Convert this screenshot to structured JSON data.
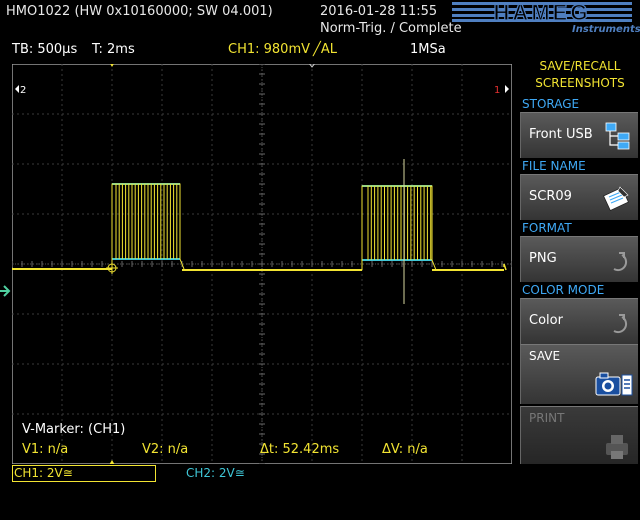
{
  "header": {
    "device": "HMO1022 (HW 0x10160000; SW 04.001)",
    "datetime": "2016-01-28 11:55",
    "mode": "Norm-Trig. / Complete",
    "logo": "HAMEG",
    "logo_sub": "Instruments"
  },
  "status_bar": {
    "timebase": "TB: 500µs",
    "trigger_time": "T: 2ms",
    "channel": "CH1: 980mV",
    "edge": "╱AL",
    "sample_rate": "1MSa"
  },
  "markers": {
    "left": "2",
    "right": "1"
  },
  "cursor_readout": {
    "title": "V-Marker: (CH1)",
    "v1": "V1: n/a",
    "v2": "V2: n/a",
    "dt": "Δt: 52.42ms",
    "dv": "ΔV: n/a"
  },
  "channels": {
    "ch1": "CH1: 2V≅",
    "ch2": "CH2: 2V≅"
  },
  "menu": {
    "title_line1": "SAVE/RECALL",
    "title_line2": "SCREENSHOTS",
    "storage_label": "STORAGE",
    "storage_value": "Front USB",
    "file_name_label": "FILE NAME",
    "file_name_value": "SCR09",
    "format_label": "FORMAT",
    "format_value": "PNG",
    "color_mode_label": "COLOR MODE",
    "color_mode_value": "Color",
    "save_label": "SAVE",
    "print_label": "PRINT"
  },
  "colors": {
    "ch1": "#f2e432",
    "ch2": "#3fc6d6",
    "menu_label": "#3fa9f5",
    "logo": "#4f7fc0"
  },
  "icons": {
    "storage": "folder-tree-icon",
    "file_name": "edit-file-icon",
    "format": "cycle-icon",
    "color_mode": "cycle-icon",
    "save": "camera-icon",
    "print": "printer-icon"
  }
}
